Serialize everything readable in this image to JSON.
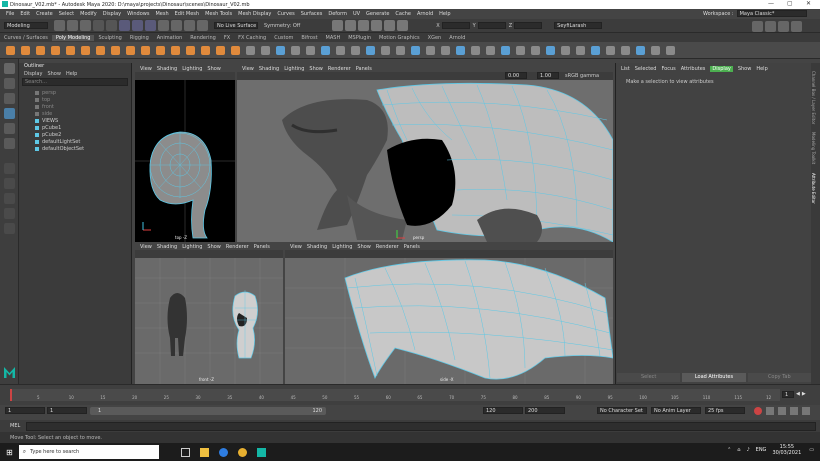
{
  "window": {
    "title": "Dinosaur_V02.mb* - Autodesk Maya 2020: D:\\maya\\projects\\Dinosaur\\scenes\\Dinosaur_V02.mb",
    "workspace_label": "Workspace :",
    "workspace_value": "Maya Classic*"
  },
  "menubar": [
    "File",
    "Edit",
    "Create",
    "Select",
    "Modify",
    "Display",
    "Windows",
    "Mesh",
    "Edit Mesh",
    "Mesh Tools",
    "Mesh Display",
    "Curves",
    "Surfaces",
    "Deform",
    "UV",
    "Generate",
    "Cache",
    "Arnold",
    "Help"
  ],
  "statusline": {
    "mode": "Modeling",
    "live_surface": "No Live Surface",
    "symmetry": "Symmetry: Off",
    "x_label": "X",
    "y_label": "Y",
    "z_label": "Z",
    "user": "SeyfiLarash"
  },
  "shelf_tabs": [
    "Curves / Surfaces",
    "Poly Modeling",
    "Sculpting",
    "Rigging",
    "Animation",
    "Rendering",
    "FX",
    "FX Caching",
    "Custom",
    "Bifrost",
    "MASH",
    "MSPlugin",
    "Motion Graphics",
    "XGen",
    "Arnold"
  ],
  "shelf_active": "Poly Modeling",
  "outliner": {
    "title": "Outliner",
    "menu": [
      "Display",
      "Show",
      "Help"
    ],
    "search_placeholder": "Search...",
    "items": [
      {
        "label": "persp",
        "dim": true
      },
      {
        "label": "top",
        "dim": true
      },
      {
        "label": "front",
        "dim": true
      },
      {
        "label": "side",
        "dim": true
      },
      {
        "label": "VIEWS",
        "dim": false
      },
      {
        "label": "pCube1",
        "dim": false
      },
      {
        "label": "pCube2",
        "dim": false
      },
      {
        "label": "defaultLightSet",
        "dim": false
      },
      {
        "label": "defaultObjectSet",
        "dim": false
      }
    ]
  },
  "viewport_menu": [
    "View",
    "Shading",
    "Lighting",
    "Show"
  ],
  "viewport_menu_full": [
    "View",
    "Shading",
    "Lighting",
    "Show",
    "Renderer",
    "Panels"
  ],
  "viewports": {
    "top": {
      "label": "top -Z"
    },
    "persp": {
      "label": "persp",
      "val1": "0.00",
      "val2": "1.00",
      "gamma": "sRGB gamma"
    },
    "front": {
      "label": "front -Z"
    },
    "side": {
      "label": "side -X"
    }
  },
  "attribute_editor": {
    "tabs": [
      "List",
      "Selected",
      "Focus",
      "Attributes",
      "Display",
      "Show",
      "Help"
    ],
    "active_tab": "Display",
    "message": "Make a selection to view attributes",
    "buttons": [
      "Select",
      "Load Attributes",
      "Copy Tab"
    ]
  },
  "sidebar_tabs": [
    "Channel Box / Layer Editor",
    "Modeling Toolkit",
    "Attribute Editor"
  ],
  "timeline": {
    "ticks": [
      "5",
      "10",
      "15",
      "20",
      "25",
      "30",
      "35",
      "40",
      "45",
      "50",
      "55",
      "60",
      "65",
      "70",
      "75",
      "80",
      "85",
      "90",
      "95",
      "100",
      "105",
      "110",
      "115",
      "12"
    ],
    "current_frame": "1"
  },
  "range": {
    "start": "1",
    "playback_start": "1",
    "slider_start": "1",
    "slider_end": "120",
    "playback_end": "120",
    "end": "200",
    "character_set": "No Character Set",
    "anim_layer": "No Anim Layer",
    "fps": "25 fps"
  },
  "command_line": {
    "label": "MEL"
  },
  "help_line": "Move Tool: Select an object to move.",
  "taskbar": {
    "search_placeholder": "Type here to search",
    "lang": "ENG",
    "time": "15:55",
    "date": "30/03/2021"
  },
  "colors": {
    "accent": "#5ec8e6",
    "active_green": "#4caf50",
    "shelf_orange": "#e08a3c",
    "maya_logo": "#14b7a6"
  }
}
